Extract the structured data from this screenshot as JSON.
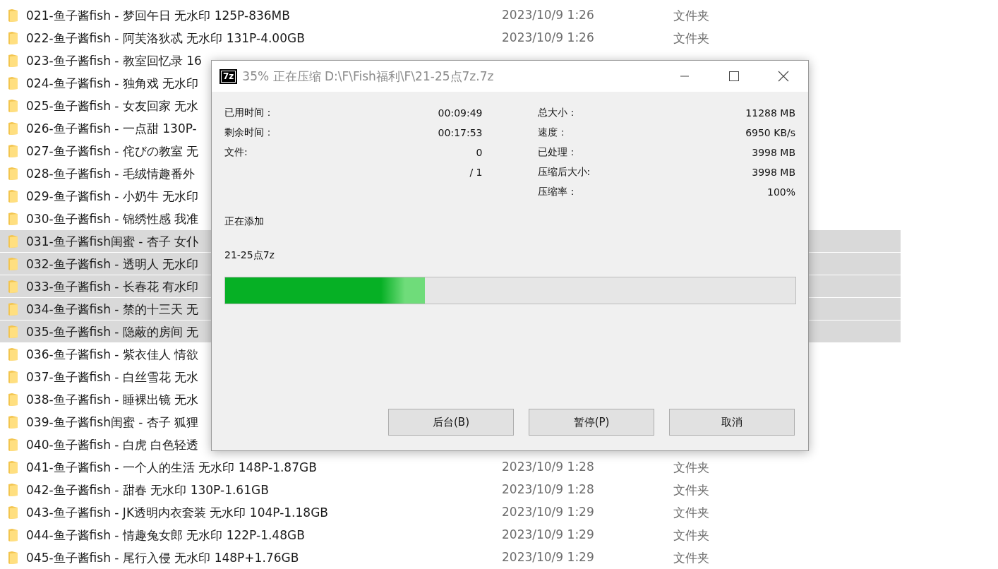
{
  "files": [
    {
      "name": "021-鱼子酱fish - 梦回午日 无水印 125P-836MB",
      "date": "2023/10/9 1:26",
      "type": "文件夹",
      "selected": false
    },
    {
      "name": "022-鱼子酱fish - 阿芙洛狄忒 无水印 131P-4.00GB",
      "date": "2023/10/9 1:26",
      "type": "文件夹",
      "selected": false
    },
    {
      "name": "023-鱼子酱fish - 教室回忆录 16",
      "selected": false
    },
    {
      "name": "024-鱼子酱fish - 独角戏 无水印",
      "selected": false
    },
    {
      "name": "025-鱼子酱fish - 女友回家 无水",
      "selected": false
    },
    {
      "name": "026-鱼子酱fish - 一点甜  130P-",
      "selected": false
    },
    {
      "name": "027-鱼子酱fish - 侘びの教室 无",
      "selected": false
    },
    {
      "name": "028-鱼子酱fish - 毛绒情趣番外",
      "selected": false
    },
    {
      "name": "029-鱼子酱fish - 小奶牛 无水印",
      "selected": false
    },
    {
      "name": "030-鱼子酱fish - 锦绣性感 我准",
      "selected": false
    },
    {
      "name": "031-鱼子酱fish闺蜜 - 杏子 女仆",
      "selected": true
    },
    {
      "name": "032-鱼子酱fish - 透明人 无水印",
      "selected": true
    },
    {
      "name": "033-鱼子酱fish - 长春花 有水印",
      "selected": true
    },
    {
      "name": "034-鱼子酱fish - 禁的十三天 无",
      "selected": true
    },
    {
      "name": "035-鱼子酱fish - 隐蔽的房间 无",
      "selected": true
    },
    {
      "name": "036-鱼子酱fish - 紫衣佳人  情欲",
      "selected": false
    },
    {
      "name": "037-鱼子酱fish - 白丝雪花 无水",
      "selected": false
    },
    {
      "name": "038-鱼子酱fish - 睡裸出镜 无水",
      "selected": false
    },
    {
      "name": "039-鱼子酱fish闺蜜 - 杏子 狐狸",
      "selected": false
    },
    {
      "name": "040-鱼子酱fish - 白虎 白色轻透",
      "selected": false
    },
    {
      "name": "041-鱼子酱fish - 一个人的生活 无水印 148P-1.87GB",
      "date": "2023/10/9 1:28",
      "type": "文件夹",
      "selected": false
    },
    {
      "name": "042-鱼子酱fish - 甜春 无水印 130P-1.61GB",
      "date": "2023/10/9 1:28",
      "type": "文件夹",
      "selected": false
    },
    {
      "name": "043-鱼子酱fish - JK透明内衣套装 无水印 104P-1.18GB",
      "date": "2023/10/9 1:29",
      "type": "文件夹",
      "selected": false
    },
    {
      "name": "044-鱼子酱fish - 情趣兔女郎 无水印 122P-1.48GB",
      "date": "2023/10/9 1:29",
      "type": "文件夹",
      "selected": false
    },
    {
      "name": "045-鱼子酱fish - 尾行入侵 无水印 148P+1.76GB",
      "date": "2023/10/9 1:29",
      "type": "文件夹",
      "selected": false
    }
  ],
  "dialog": {
    "app_icon": "7z",
    "title": "35% 正在压缩 D:\\F\\Fish福利\\F\\21-25点7z.7z",
    "stats_left": [
      {
        "label": "已用时间：",
        "value": "00:09:49"
      },
      {
        "label": "剩余时间：",
        "value": "00:17:53"
      },
      {
        "label": "文件:",
        "value": "0"
      },
      {
        "value": "/ 1"
      }
    ],
    "stats_right": [
      {
        "label": "总大小：",
        "value": "11288 MB"
      },
      {
        "label": "速度：",
        "value": "6950 KB/s"
      },
      {
        "label": "已处理：",
        "value": "3998 MB"
      },
      {
        "label": "压缩后大小:",
        "value": "3998 MB"
      },
      {
        "label": "压缩率：",
        "value": "100%"
      }
    ],
    "status": "正在添加",
    "current_file": "21-25点7z",
    "progress": {
      "level": 0.35
    },
    "buttons": [
      "后台(B)",
      "暂停(P)",
      "取消"
    ]
  }
}
